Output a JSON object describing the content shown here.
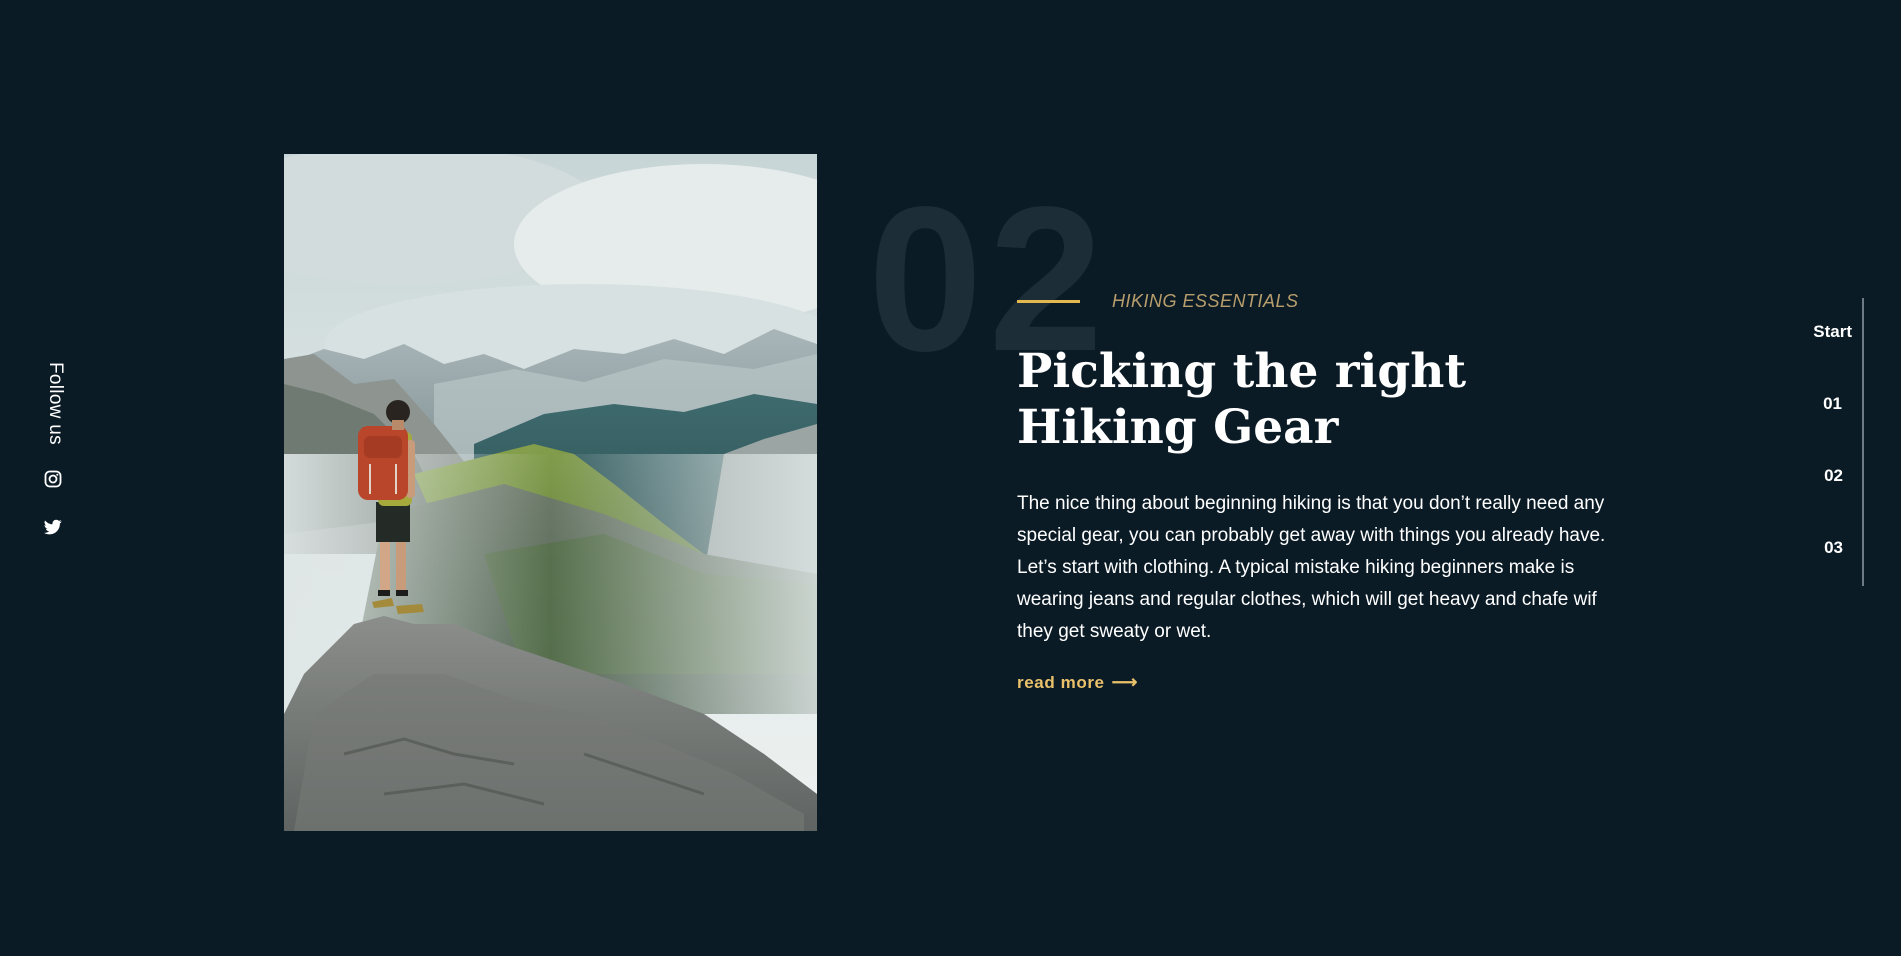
{
  "social": {
    "follow_label": "Follow us",
    "icons": [
      "instagram-icon",
      "twitter-icon"
    ]
  },
  "hero": {
    "image_subject": "hiker-on-mountain-ridge",
    "slide_number": "02"
  },
  "article": {
    "eyebrow": "HIKING ESSENTIALS",
    "title_line1": "Picking the right",
    "title_line2": "Hiking Gear",
    "body": "The nice thing about beginning hiking is that you don’t really need any special gear, you can probably get away with things you already have. Let’s start with clothing. A typical mistake hiking beginners make is wearing jeans and regular clothes, which will get heavy and chafe wif they get sweaty or wet.",
    "read_more": "read more",
    "read_more_arrow": "⟶"
  },
  "slide_nav": {
    "items": [
      {
        "label": "Start"
      },
      {
        "label": "01"
      },
      {
        "label": "02"
      },
      {
        "label": "03"
      }
    ]
  },
  "colors": {
    "background": "#0b1b26",
    "accent": "#e3b94f",
    "eyebrow_text": "#b89e6c",
    "big_number": "#1d2d38",
    "text": "#ffffff"
  }
}
